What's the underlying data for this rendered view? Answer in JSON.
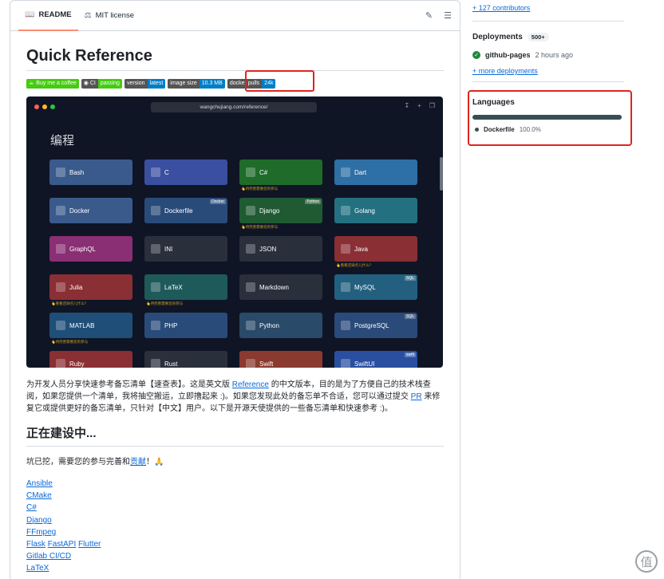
{
  "readme": {
    "tabs": [
      {
        "label": "README",
        "icon": "book-icon"
      },
      {
        "label": "MIT license",
        "icon": "scale-icon"
      }
    ],
    "title": "Quick Reference",
    "badges": [
      {
        "left": "Buy me a coffee",
        "right": ""
      },
      {
        "left": "CI",
        "right": "passing"
      },
      {
        "left": "version",
        "right": "latest"
      },
      {
        "left": "image size",
        "right": "10.3 MB"
      },
      {
        "left": "docker pulls",
        "right": "24k"
      }
    ],
    "screenshot": {
      "url": "wangchujiang.com/reference/",
      "heading": "编程",
      "tiles": [
        {
          "label": "Bash",
          "color": "#3a5a8c",
          "tag": "",
          "note": ""
        },
        {
          "label": "C",
          "color": "#3a4fa0",
          "tag": "",
          "note": ""
        },
        {
          "label": "C#",
          "color": "#1f6b2a",
          "tag": "",
          "note": "👆待完善需要您的参与"
        },
        {
          "label": "Dart",
          "color": "#2e6fa5",
          "tag": "",
          "note": ""
        },
        {
          "label": "Docker",
          "color": "#3a5a8c",
          "tag": "",
          "note": ""
        },
        {
          "label": "Dockerfile",
          "color": "#294b7a",
          "tag": "Docker",
          "note": ""
        },
        {
          "label": "Django",
          "color": "#1f5a33",
          "tag": "Python",
          "note": "👆待完善需要您的参与"
        },
        {
          "label": "Golang",
          "color": "#237080",
          "tag": "",
          "note": ""
        },
        {
          "label": "GraphQL",
          "color": "#8a2f74",
          "tag": "",
          "note": ""
        },
        {
          "label": "INI",
          "color": "#2a2f3c",
          "tag": "",
          "note": ""
        },
        {
          "label": "JSON",
          "color": "#2a2f3c",
          "tag": "",
          "note": ""
        },
        {
          "label": "Java",
          "color": "#8a2f34",
          "tag": "",
          "note": "👆看看还缺点儿什么？"
        },
        {
          "label": "Julia",
          "color": "#8a2f34",
          "tag": "",
          "note": "👆看看还缺点儿什么？"
        },
        {
          "label": "LaTeX",
          "color": "#1f5a5a",
          "tag": "",
          "note": "👆待完善需要您的参与"
        },
        {
          "label": "Markdown",
          "color": "#2a2f3c",
          "tag": "",
          "note": ""
        },
        {
          "label": "MySQL",
          "color": "#236080",
          "tag": "SQL",
          "note": ""
        },
        {
          "label": "MATLAB",
          "color": "#1f4f78",
          "tag": "",
          "note": "👆待完善需要您的参与"
        },
        {
          "label": "PHP",
          "color": "#294b7a",
          "tag": "",
          "note": ""
        },
        {
          "label": "Python",
          "color": "#2a4a6a",
          "tag": "",
          "note": ""
        },
        {
          "label": "PostgreSQL",
          "color": "#2a4a7a",
          "tag": "SQL",
          "note": ""
        },
        {
          "label": "Ruby",
          "color": "#8a2f34",
          "tag": "",
          "note": ""
        },
        {
          "label": "Rust",
          "color": "#2a2f3c",
          "tag": "",
          "note": ""
        },
        {
          "label": "Swift",
          "color": "#8a3a2f",
          "tag": "",
          "note": ""
        },
        {
          "label": "SwiftUI",
          "color": "#2a4fa0",
          "tag": "swift",
          "note": ""
        }
      ]
    },
    "intro_parts": {
      "p1": "为开发人员分享快速参考备忘清单【速查表】。这是英文版 ",
      "link1": "Reference",
      "p2": " 的中文版本，目的是为了方便自己的技术栈查阅，如果您提供一个清单，我将抽空搬运，立即撸起来 :)。如果您发现此处的备忘单不合适，您可以通过提交 ",
      "link2": "PR",
      "p3": " 来修复它或提供更好的备忘清单，只针对【中文】用户。以下是开源天使提供的一些备忘清单和快速参考 :)。"
    },
    "section_title": "正在建设中...",
    "wip_parts": {
      "text": "坑已挖，需要您的参与完善和",
      "link": "贡献",
      "tail": "！🙏"
    },
    "links": [
      [
        "Ansible"
      ],
      [
        "CMake"
      ],
      [
        "C#"
      ],
      [
        "Django"
      ],
      [
        "FFmpeg"
      ],
      [
        "Flask",
        "FastAPI",
        "Flutter"
      ],
      [
        "Gitlab CI/CD"
      ],
      [
        "LaTeX"
      ]
    ]
  },
  "sidebar": {
    "contributors": "+ 127 contributors",
    "deployments_title": "Deployments",
    "deployments_count": "500+",
    "deployment": {
      "name": "github-pages",
      "time": "2 hours ago"
    },
    "more_deployments": "+ more deployments",
    "languages_title": "Languages",
    "language": {
      "name": "Dockerfile",
      "percent": "100.0%",
      "color": "#384d54"
    }
  }
}
